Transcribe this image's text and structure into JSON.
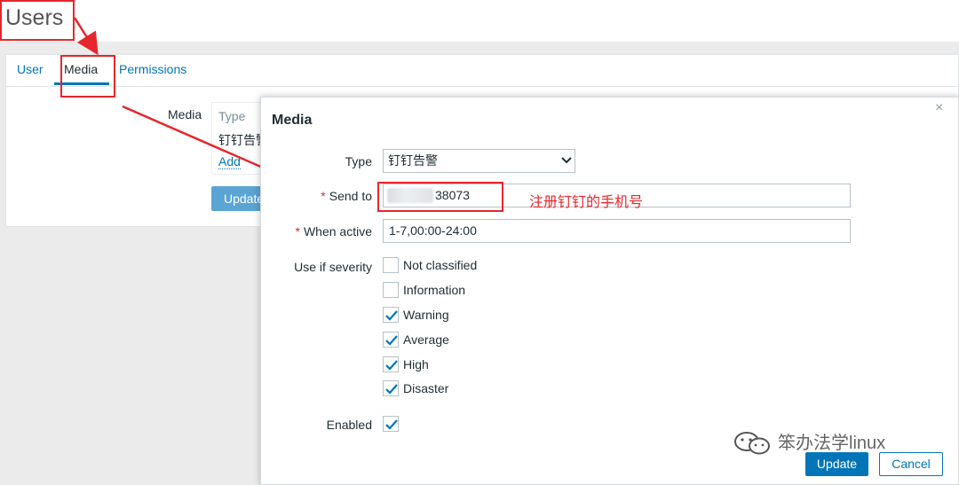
{
  "header": {
    "title": "Users"
  },
  "tabs": [
    {
      "label": "User"
    },
    {
      "label": "Media"
    },
    {
      "label": "Permissions"
    }
  ],
  "background_form": {
    "media_label": "Media",
    "type_header": "Type",
    "media_value": "钉钉告警",
    "add_link": "Add",
    "update_button": "Update"
  },
  "modal": {
    "title": "Media",
    "close_glyph": "×",
    "type_label": "Type",
    "type_value": "钉钉告警",
    "send_to_label": "Send to",
    "send_to_value": "38073",
    "when_active_label": "When active",
    "when_active_value": "1-7,00:00-24:00",
    "severity_label": "Use if severity",
    "severities": [
      {
        "label": "Not classified",
        "checked": false
      },
      {
        "label": "Information",
        "checked": false
      },
      {
        "label": "Warning",
        "checked": true
      },
      {
        "label": "Average",
        "checked": true
      },
      {
        "label": "High",
        "checked": true
      },
      {
        "label": "Disaster",
        "checked": true
      }
    ],
    "enabled_label": "Enabled",
    "enabled_checked": true,
    "update_button": "Update",
    "cancel_button": "Cancel",
    "required_mark": "*"
  },
  "annotation": {
    "text": "注册钉钉的手机号",
    "color": "#e5262c"
  },
  "watermark": {
    "text": "笨办法学linux"
  },
  "colors": {
    "accent": "#0275b8",
    "annotation_red": "#e5262c",
    "check": "#0275b8"
  }
}
